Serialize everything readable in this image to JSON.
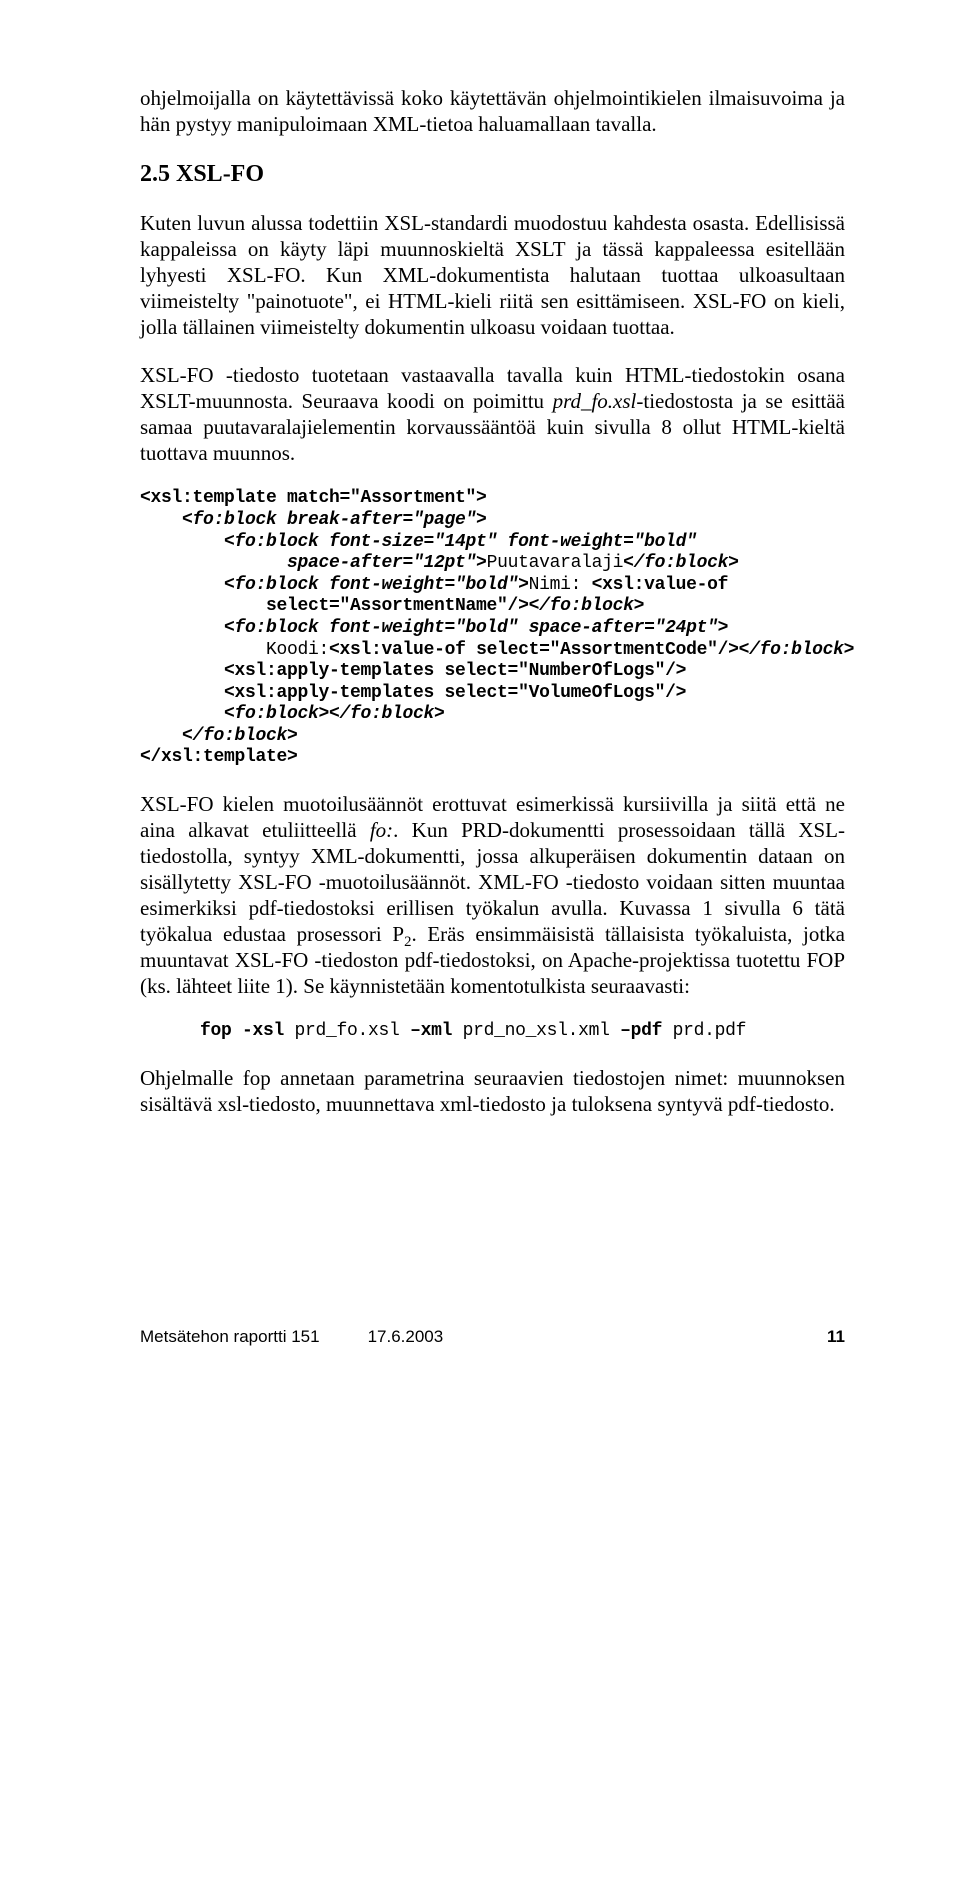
{
  "para_intro": "ohjelmoijalla on käytettävissä koko käytettävän ohjelmointikielen ilmaisuvoima ja hän pystyy manipuloimaan XML-tietoa haluamallaan tavalla.",
  "heading": "2.5   XSL-FO",
  "para1": "Kuten luvun alussa todettiin XSL-standardi muodostuu kahdesta osasta. Edellisissä kappaleissa on käyty läpi muunnoskieltä XSLT ja tässä kappaleessa esitellään lyhyesti XSL-FO. Kun XML-dokumentista halutaan tuottaa ulkoasultaan viimeistelty \"painotuote\", ei HTML-kieli riitä sen esittämiseen. XSL-FO on kieli, jolla tällainen viimeistelty dokumentin ulkoasu voidaan tuottaa.",
  "para2_a": "XSL-FO -tiedosto tuotetaan vastaavalla tavalla kuin HTML-tiedostokin osana XSLT-muunnosta. Seuraava koodi on poimittu ",
  "para2_i": "prd_fo.xsl",
  "para2_b": "-tiedostosta ja se esittää samaa puutavaralajielementin korvaussääntöä kuin sivulla 8 ollut HTML-kieltä tuottava muunnos.",
  "code1": {
    "l1a": "<xsl:template match=\"Assortment\">",
    "l2": "    <fo:block break-after=\"page\">",
    "l3": "        <fo:block font-size=\"14pt\" font-weight=\"bold\"",
    "l4a": "              space-after=\"12pt\">",
    "l4b": "Puutavaralaji",
    "l4c": "</fo:block>",
    "l5a": "        <fo:block font-weight=\"bold\">",
    "l5b": "Nimi: ",
    "l5c": "<xsl:value-of",
    "l6a": "            select=\"AssortmentName\"/>",
    "l6b": "</fo:block>",
    "l7": "        <fo:block font-weight=\"bold\" space-after=\"24pt\">",
    "l8a": "            Koodi:",
    "l8b": "<xsl:value-of select=\"AssortmentCode\"/>",
    "l8c": "</fo:block>",
    "l9": "        <xsl:apply-templates select=\"NumberOfLogs\"/>",
    "l10": "        <xsl:apply-templates select=\"VolumeOfLogs\"/>",
    "l11": "        <fo:block></fo:block>",
    "l12": "    </fo:block>",
    "l13": "</xsl:template>"
  },
  "para3_a": "XSL-FO kielen muotoilusäännöt erottuvat esimerkissä kursiivilla ja siitä että ne aina alkavat etuliitteellä ",
  "para3_i1": "fo:",
  "para3_b": ". Kun PRD-dokumentti prosessoidaan tällä XSL-tiedostolla, syntyy XML-dokumentti, jossa alkuperäisen dokumentin dataan on sisällytetty XSL-FO -muotoilusäännöt. XML-FO -tiedosto voidaan sitten muuntaa esimerkiksi pdf-tiedostoksi erillisen työkalun avulla. Kuvassa 1 sivulla 6 tätä työkalua edustaa prosessori P",
  "para3_sub": "2",
  "para3_c": ". Eräs ensimmäisistä tällaisista työkaluista, jotka muuntavat XSL-FO -tiedoston pdf-tiedostoksi, on Apache-projektissa tuotettu FOP (ks. lähteet liite 1). Se käynnistetään komentotulkista seuraavasti:",
  "code2": {
    "b1": "fop -xsl ",
    "n1": "prd_fo.xsl ",
    "b2": "–xml ",
    "n2": "prd_no_xsl.xml ",
    "b3": "–pdf ",
    "n3": "prd.pdf"
  },
  "para4": "Ohjelmalle fop annetaan parametrina seuraavien tiedostojen nimet: muunnoksen sisältävä xsl-tiedosto, muunnettava xml-tiedosto ja tuloksena syntyvä pdf-tiedosto.",
  "footer": {
    "left1": "Metsätehon raportti 151",
    "left2": "17.6.2003",
    "right": "11"
  }
}
